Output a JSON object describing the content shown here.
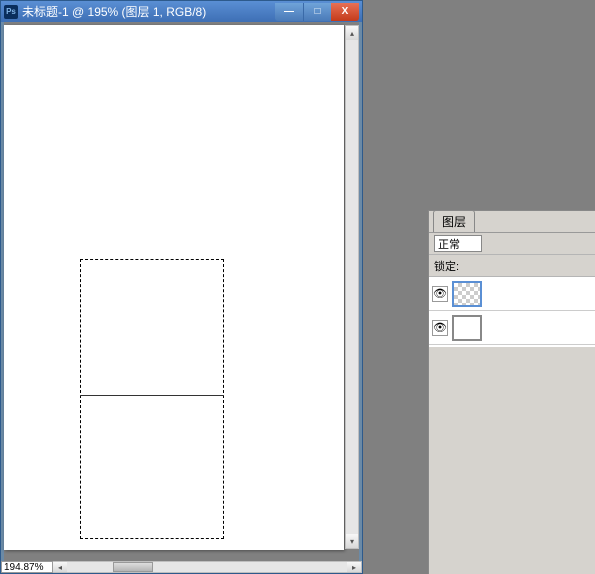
{
  "titlebar": {
    "ps_icon": "Ps",
    "title": "未标题-1 @ 195% (图层 1, RGB/8)"
  },
  "window_controls": {
    "minimize": "—",
    "maximize": "□",
    "close": "X"
  },
  "statusbar": {
    "zoom": "194.87%"
  },
  "scrollbar": {
    "arrow_up": "▴",
    "arrow_down": "▾",
    "arrow_left": "◂",
    "arrow_right": "▸"
  },
  "layers_panel": {
    "tab": "图层",
    "blend_mode": "正常",
    "lock_label": "锁定:",
    "layers": [
      {
        "visible": true,
        "selected": true
      },
      {
        "visible": true,
        "selected": false
      }
    ]
  }
}
